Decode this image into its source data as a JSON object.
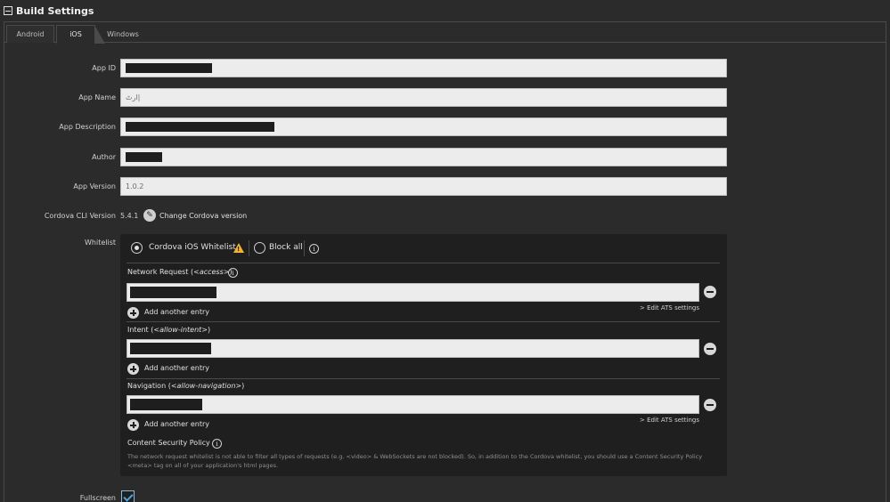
{
  "header": {
    "title": "Build Settings"
  },
  "tabs": [
    {
      "label": "Android"
    },
    {
      "label": "iOS"
    },
    {
      "label": "Windows"
    }
  ],
  "fields": {
    "app_id": {
      "label": "App ID",
      "value": ""
    },
    "app_name": {
      "label": "App Name",
      "value": "ارٹ|"
    },
    "app_description": {
      "label": "App Description",
      "value": ""
    },
    "author": {
      "label": "Author",
      "value": ""
    },
    "app_version": {
      "label": "App Version",
      "value": "1.0.2"
    }
  },
  "cordova": {
    "label": "Cordova CLI Version",
    "version": "5.4.1",
    "change_label": "Change Cordova version"
  },
  "whitelist": {
    "label": "Whitelist",
    "option_cordova": "Cordova iOS Whitelist",
    "option_block": "Block all",
    "network_title": "Network Request (",
    "network_tag": "<access>",
    "intent_title": "Intent (",
    "intent_tag": "<allow-intent>",
    "navigation_title": "Navigation (",
    "navigation_tag": "<allow-navigation>",
    "close_paren": ")",
    "add_entry": "Add another entry",
    "ats_link": "> Edit ATS settings",
    "csp_title": "Content Security Policy",
    "csp_text": "The network request whitelist is not able to filter all types of requests (e.g. <video> & WebSockets are not blocked). So, in addition to the Cordova whitelist, you should use a Content Security Policy <meta> tag on all of your application's html pages."
  },
  "fullscreen": {
    "label": "Fullscreen",
    "checked": true
  },
  "colors": {
    "background": "#2b2b2b",
    "input": "#ececec",
    "accent": "#4aa6e6",
    "warning": "#f2b230"
  },
  "icons": [
    "collapse-icon",
    "pencil-icon",
    "warning-icon",
    "info-icon",
    "remove-icon",
    "add-icon",
    "checkmark-icon"
  ]
}
